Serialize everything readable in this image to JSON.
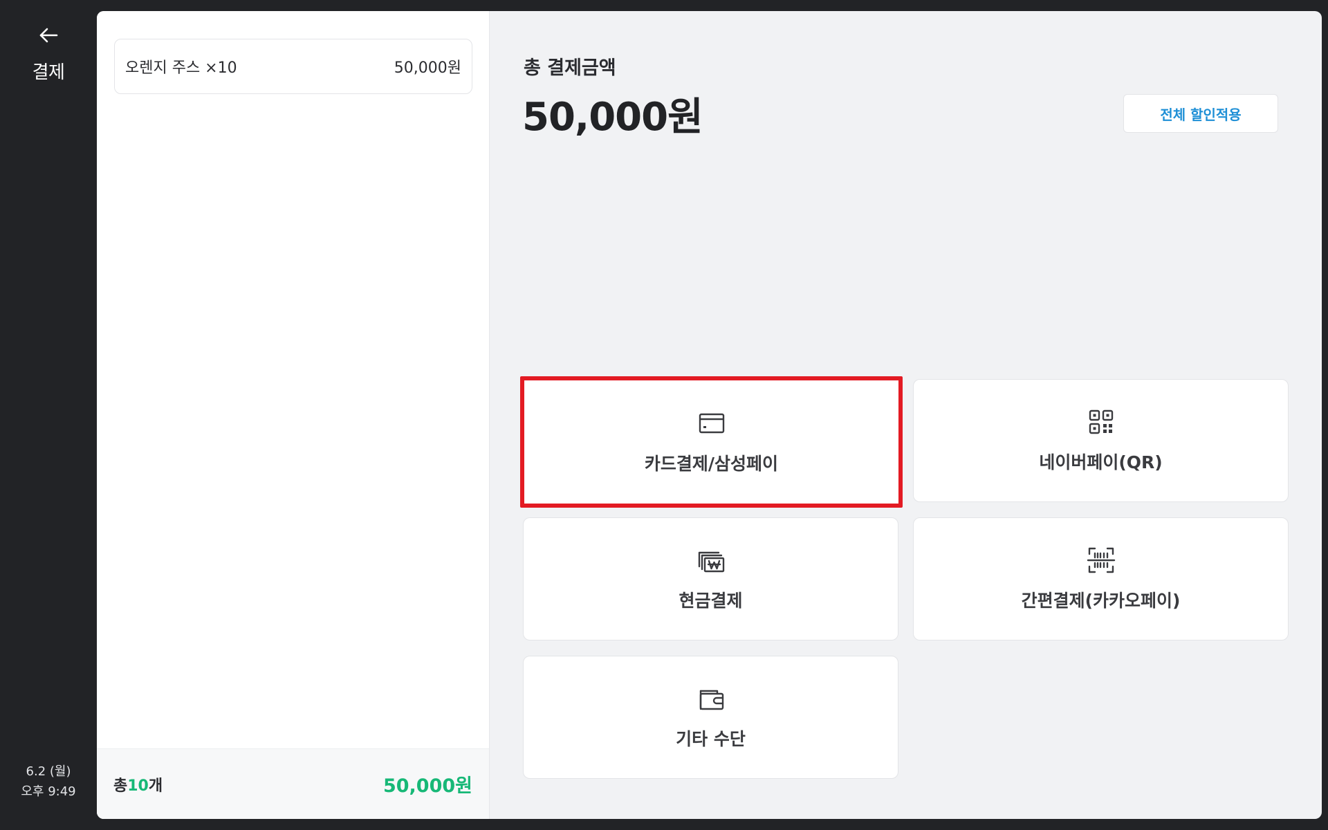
{
  "sidebar": {
    "back_label": "결제",
    "date": "6.2 (월)",
    "time": "오후 9:49"
  },
  "order": {
    "items": [
      {
        "name": "오렌지 주스 ×10",
        "price": "50,000원"
      }
    ],
    "count_prefix": "총",
    "count_number": "10",
    "count_suffix": "개",
    "total": "50,000원"
  },
  "payment": {
    "total_label": "총 결제금액",
    "total_amount": "50,000원",
    "discount_button": "전체 할인적용",
    "methods": [
      {
        "label": "카드결제/삼성페이",
        "icon": "credit-card-icon",
        "highlighted": true
      },
      {
        "label": "네이버페이(QR)",
        "icon": "qr-code-icon"
      },
      {
        "label": "현금결제",
        "icon": "cash-won-icon"
      },
      {
        "label": "간편결제(카카오페이)",
        "icon": "barcode-scan-icon"
      },
      {
        "label": "기타 수단",
        "icon": "wallet-icon"
      }
    ]
  },
  "colors": {
    "accent_green": "#17b877",
    "link_blue": "#1e8fd6",
    "highlight_red": "#e31b23"
  }
}
